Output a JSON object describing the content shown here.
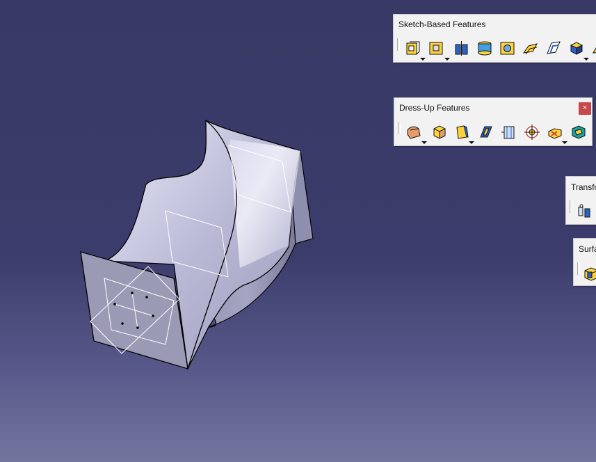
{
  "toolbars": {
    "sketch_based": {
      "title": "Sketch-Based Features",
      "icons": [
        "pad-icon",
        "pocket-icon",
        "shaft-icon",
        "groove-icon",
        "hole-icon",
        "rib-icon",
        "slot-icon",
        "multi-sections-solid-icon",
        "removed-multi-sections-icon"
      ]
    },
    "dress_up": {
      "title": "Dress-Up Features",
      "close": "×",
      "icons": [
        "edge-fillet-icon",
        "chamfer-icon",
        "draft-icon",
        "shell-icon",
        "thickness-icon",
        "thread-icon",
        "remove-face-icon",
        "replace-face-icon"
      ]
    },
    "transformation": {
      "title": "Transfo",
      "icons": [
        "translation-icon"
      ]
    },
    "surface_based": {
      "title": "Surfa",
      "icons": [
        "split-icon"
      ]
    }
  },
  "colors": {
    "background_top": "#393966",
    "background_bottom": "#74759f",
    "part_light": "#d6d6ea",
    "part_mid": "#a9a9c6",
    "part_dark": "#7d7d9c",
    "close_button": "#c8474b"
  }
}
